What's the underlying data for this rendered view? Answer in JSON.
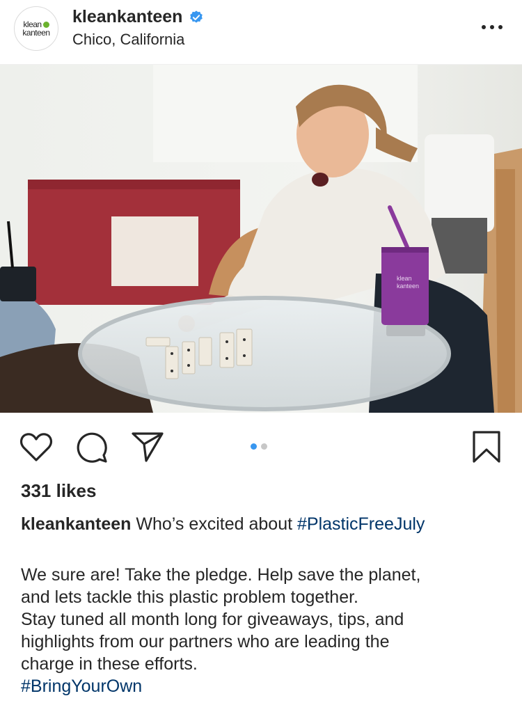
{
  "header": {
    "username": "kleankanteen",
    "location": "Chico, California",
    "avatar_text_line1": "klean",
    "avatar_text_line2": "kanteen"
  },
  "post": {
    "image_cup_text_line1": "klean",
    "image_cup_text_line2": "kanteen",
    "carousel": {
      "count": 2,
      "active_index": 0
    },
    "likes": "331 likes",
    "caption": {
      "user": "kleankanteen",
      "text": "Who’s excited about ",
      "hashtag": "#PlasticFreeJuly"
    },
    "body": {
      "line1": "We sure are! Take the pledge. Help save the planet,",
      "line2": "and lets tackle this plastic problem together.",
      "line3": "Stay tuned all month long for giveaways, tips, and",
      "line4": "highlights from our partners who are leading the",
      "line5": "charge in these efforts.",
      "hashtag": "#BringYourOwn"
    }
  },
  "icons": {
    "verified": "verified-badge-icon",
    "more": "more-options-icon",
    "like": "heart-icon",
    "comment": "comment-icon",
    "share": "send-icon",
    "save": "bookmark-icon"
  },
  "colors": {
    "verified_blue": "#3897f0",
    "hashtag": "#003569",
    "carousel_active": "#3897f0",
    "carousel_inactive": "#c7c7c7",
    "cup_purple": "#8a3a9c",
    "cabinet_red": "#a3303a"
  }
}
